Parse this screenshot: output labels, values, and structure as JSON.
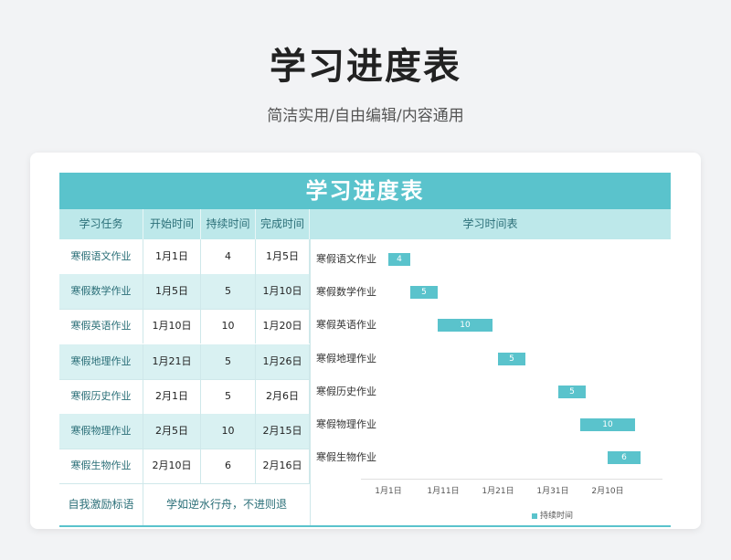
{
  "page": {
    "title": "学习进度表",
    "subtitle": "简洁实用/自由编辑/内容通用"
  },
  "sheet": {
    "banner": "学习进度表",
    "headers": [
      "学习任务",
      "开始时间",
      "持续时间",
      "完成时间",
      "学习时间表"
    ],
    "rows": [
      {
        "task": "寒假语文作业",
        "start": "1月1日",
        "duration": "4",
        "end": "1月5日"
      },
      {
        "task": "寒假数学作业",
        "start": "1月5日",
        "duration": "5",
        "end": "1月10日"
      },
      {
        "task": "寒假英语作业",
        "start": "1月10日",
        "duration": "10",
        "end": "1月20日"
      },
      {
        "task": "寒假地理作业",
        "start": "1月21日",
        "duration": "5",
        "end": "1月26日"
      },
      {
        "task": "寒假历史作业",
        "start": "2月1日",
        "duration": "5",
        "end": "2月6日"
      },
      {
        "task": "寒假物理作业",
        "start": "2月5日",
        "duration": "10",
        "end": "2月15日"
      },
      {
        "task": "寒假生物作业",
        "start": "2月10日",
        "duration": "6",
        "end": "2月16日"
      }
    ],
    "footer": {
      "label": "自我激励标语",
      "text": "学如逆水行舟，不进则退"
    }
  },
  "chart_data": {
    "type": "bar",
    "orientation": "horizontal-gantt",
    "categories": [
      "寒假语文作业",
      "寒假数学作业",
      "寒假英语作业",
      "寒假地理作业",
      "寒假历史作业",
      "寒假物理作业",
      "寒假生物作业"
    ],
    "start": [
      "1月1日",
      "1月5日",
      "1月10日",
      "1月21日",
      "2月1日",
      "2月5日",
      "2月10日"
    ],
    "start_day": [
      1,
      5,
      10,
      21,
      32,
      36,
      41
    ],
    "series": [
      {
        "name": "持续时间",
        "values": [
          4,
          5,
          10,
          5,
          5,
          10,
          6
        ]
      }
    ],
    "x_ticks": [
      {
        "label": "1月1日",
        "day": 1
      },
      {
        "label": "1月11日",
        "day": 11
      },
      {
        "label": "1月21日",
        "day": 21
      },
      {
        "label": "1月31日",
        "day": 31
      },
      {
        "label": "2月10日",
        "day": 41
      }
    ],
    "xlim": [
      -4,
      51
    ],
    "legend": "bottom",
    "bar_color": "#5ac3cc"
  },
  "colors": {
    "accent": "#5ac3cc",
    "header_bg": "#bde8ea",
    "alt_row": "#d9f1f2"
  }
}
